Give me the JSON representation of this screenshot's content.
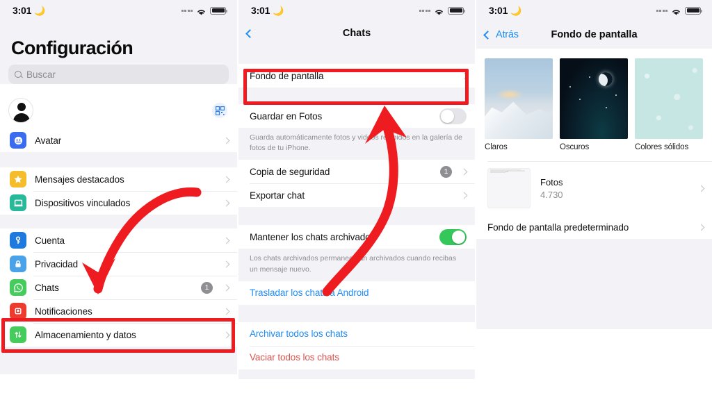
{
  "status_bar": {
    "time": "3:01",
    "moon_icon": "crescent-moon-icon",
    "wifi_icon": "wifi-icon",
    "battery_icon": "battery-icon"
  },
  "panel_settings": {
    "title": "Configuración",
    "search": {
      "placeholder": "Buscar",
      "icon": "search-icon"
    },
    "profile": {
      "avatar_icon": "avatar-placeholder-icon",
      "qr_icon": "qr-code-icon"
    },
    "groups": [
      {
        "items": [
          {
            "label": "Avatar",
            "icon": "avatar-app-icon",
            "color": "#3b6bf0",
            "glyph": "◓",
            "badge": ""
          }
        ]
      },
      {
        "items": [
          {
            "label": "Mensajes destacados",
            "icon": "star-icon",
            "color": "#f5bc2b",
            "glyph": "★",
            "badge": ""
          },
          {
            "label": "Dispositivos vinculados",
            "icon": "laptop-icon",
            "color": "#26b99a",
            "glyph": "▭",
            "badge": ""
          }
        ]
      },
      {
        "items": [
          {
            "label": "Cuenta",
            "icon": "key-icon",
            "color": "#1f7ae0",
            "glyph": "⚿",
            "badge": ""
          },
          {
            "label": "Privacidad",
            "icon": "lock-icon",
            "color": "#4aa3e8",
            "glyph": "🔒",
            "badge": ""
          },
          {
            "label": "Chats",
            "icon": "whatsapp-chat-icon",
            "color": "#46cc5d",
            "glyph": "✆",
            "badge": "1"
          },
          {
            "label": "Notificaciones",
            "icon": "bell-icon",
            "color": "#ee3b30",
            "glyph": "◲",
            "badge": ""
          },
          {
            "label": "Almacenamiento y datos",
            "icon": "arrows-updown-icon",
            "color": "#46cc5d",
            "glyph": "⇅",
            "badge": ""
          }
        ]
      }
    ]
  },
  "panel_chats": {
    "nav": {
      "back_icon": "chevron-left-icon",
      "title": "Chats"
    },
    "rows": [
      {
        "label": "Fondo de pantalla",
        "type": "link",
        "chevron": true
      },
      {
        "label": "Guardar en Fotos",
        "type": "toggle",
        "toggle_on": false
      },
      {
        "footnote": "Guarda automáticamente fotos y videos recibidos en la galería de fotos de tu iPhone."
      },
      {
        "label": "Copia de seguridad",
        "type": "link",
        "badge": "1",
        "chevron": true
      },
      {
        "label": "Exportar chat",
        "type": "link",
        "chevron": true
      },
      {
        "label": "Mantener los chats archivados",
        "type": "toggle",
        "toggle_on": true
      },
      {
        "footnote": "Los chats archivados permanecerán archivados cuando recibas un mensaje nuevo."
      },
      {
        "label": "Trasladar los chats a Android",
        "type": "action-blue"
      },
      {
        "label": "Archivar todos los chats",
        "type": "action-blue"
      },
      {
        "label": "Vaciar todos los chats",
        "type": "action-red"
      }
    ]
  },
  "panel_wallpaper": {
    "nav": {
      "back_icon": "chevron-left-icon",
      "back_label": "Atrás",
      "title": "Fondo de pantalla"
    },
    "thumbs": [
      {
        "caption": "Claros",
        "art": "mountain-photo"
      },
      {
        "caption": "Oscuros",
        "art": "night-moon-photo"
      },
      {
        "caption": "Colores sólidos",
        "art": "solid-teal-pattern"
      }
    ],
    "photos_row": {
      "title": "Fotos",
      "count": "4.730",
      "thumb": "screenshot-thumb"
    },
    "default_row": {
      "label": "Fondo de pantalla predeterminado"
    }
  },
  "annotations": {
    "color": "#ee1c20",
    "boxes": [
      {
        "name": "highlight-chats-row"
      },
      {
        "name": "highlight-fondo-de-pantalla-row"
      }
    ],
    "arrows": [
      {
        "name": "arrow-to-chats"
      },
      {
        "name": "arrow-to-fondo-de-pantalla"
      }
    ]
  }
}
